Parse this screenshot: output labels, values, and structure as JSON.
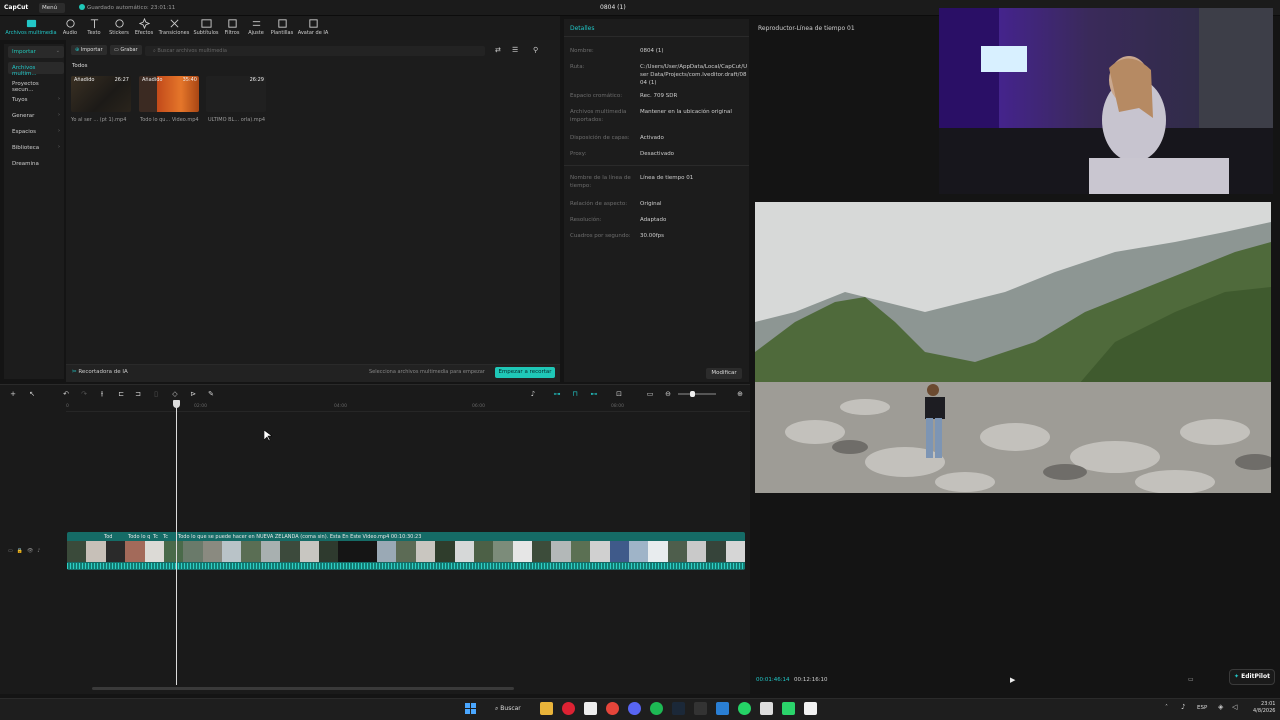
{
  "titlebar": {
    "logo": "CapCut",
    "menu": "Menú",
    "autosave": "Guardado automático: 23:01:11",
    "project_title": "0804 (1)"
  },
  "toolbar": {
    "items": [
      {
        "label": "Archivos multimedia",
        "icon": "media-icon"
      },
      {
        "label": "Audio",
        "icon": "audio-icon"
      },
      {
        "label": "Texto",
        "icon": "text-icon"
      },
      {
        "label": "Stickers",
        "icon": "sticker-icon"
      },
      {
        "label": "Efectos",
        "icon": "effects-icon"
      },
      {
        "label": "Transiciones",
        "icon": "transitions-icon"
      },
      {
        "label": "Subtítulos",
        "icon": "subtitles-icon"
      },
      {
        "label": "Filtros",
        "icon": "filters-icon"
      },
      {
        "label": "Ajuste",
        "icon": "adjust-icon"
      },
      {
        "label": "Plantillas",
        "icon": "templates-icon"
      },
      {
        "label": "Avatar de IA",
        "icon": "avatar-icon"
      }
    ]
  },
  "left_nav": {
    "items": [
      {
        "label": "Importar",
        "chevron": "⌄"
      },
      {
        "label": "Archivos multim...",
        "chevron": ""
      },
      {
        "label": "Proyectos secun...",
        "chevron": ""
      },
      {
        "label": "Tuyos",
        "chevron": "›"
      },
      {
        "label": "Generar",
        "chevron": "›"
      },
      {
        "label": "Espacios",
        "chevron": "›"
      },
      {
        "label": "Biblioteca",
        "chevron": "›"
      },
      {
        "label": "Dreamina",
        "chevron": ""
      }
    ]
  },
  "media": {
    "import_btn": "Importar",
    "record_btn": "Grabar",
    "search_placeholder": "Buscar archivos multimedia",
    "filter_all": "Todos",
    "clips": [
      {
        "tag": "Añadido",
        "duration": "26:27",
        "caption": "Yo al ser ... (pt 1).mp4"
      },
      {
        "tag": "Añadido",
        "duration": "35:40",
        "caption": "Todo lo qu... Video.mp4"
      },
      {
        "tag": "",
        "duration": "26:29",
        "caption": "ÚLTIMO BL... orla).mp4"
      }
    ],
    "ai_cutter": "Recortadora de IA",
    "select_hint": "Selecciona archivos multimedia para empezar",
    "start_btn": "Empezar a recortar"
  },
  "details": {
    "header": "Detalles",
    "rows": [
      {
        "label": "Nombre:",
        "value": "0804 (1)"
      },
      {
        "label": "Ruta:",
        "value": "C:/Users/User/AppData/Local/CapCut/User Data/Projects/com.lveditor.draft/0804 (1)"
      },
      {
        "label": "Espacio cromático:",
        "value": "Rec. 709 SDR"
      },
      {
        "label": "Archivos multimedia importados:",
        "value": "Mantener en la ubicación original"
      },
      {
        "label": "Disposición de capas:",
        "value": "Activado"
      },
      {
        "label": "Proxy:",
        "value": "Desactivado"
      },
      {
        "label": "Nombre de la línea de tiempo:",
        "value": "Línea de tiempo 01"
      },
      {
        "label": "Relación de aspecto:",
        "value": "Original"
      },
      {
        "label": "Resolución:",
        "value": "Adaptado"
      },
      {
        "label": "Cuadros por segundo:",
        "value": "30.00fps"
      }
    ],
    "modify_btn": "Modificar"
  },
  "player": {
    "title": "Reproductor-Línea de tiempo 01",
    "current_time": "00:01:46:14",
    "total_time": "00:12:16:10",
    "editpilot": "EditPilot"
  },
  "timeline": {
    "ruler": [
      "0",
      "02:00",
      "04:00",
      "06:00",
      "08:00"
    ],
    "clip_label": "Todo lo que se puede hacer en NUEVA ZELANDA (coma sin). Esta En Este Video.mp4  00:10:30:23",
    "short_labels": [
      "Tod",
      "Todo lo q",
      "Tc",
      "Tc"
    ]
  },
  "taskbar": {
    "search": "Buscar",
    "lang": "ESP",
    "time": "23:01",
    "date": "4/8/2026"
  }
}
